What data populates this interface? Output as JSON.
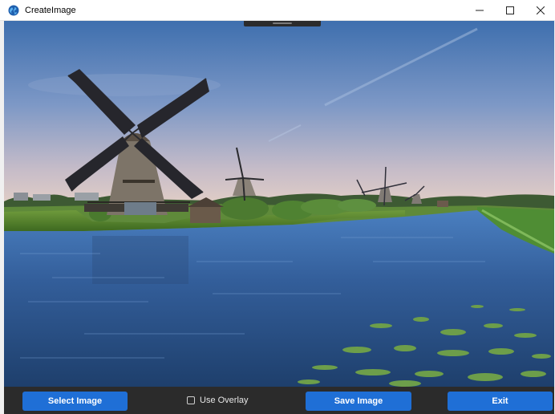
{
  "window": {
    "title": "CreateImage",
    "controls": {
      "minimize": "—",
      "maximize": "☐",
      "close": "✕"
    },
    "app_icon": "globe-icon"
  },
  "canvas": {
    "image_description_icon": "photo"
  },
  "toolbar": {
    "select_label": "Select Image",
    "overlay_label": "Use Overlay",
    "overlay_checked": false,
    "save_label": "Save Image",
    "exit_label": "Exit"
  },
  "colors": {
    "button_blue": "#1f6fd6",
    "bar_dark": "#2b2b2b",
    "titlebar": "#ffffff"
  }
}
